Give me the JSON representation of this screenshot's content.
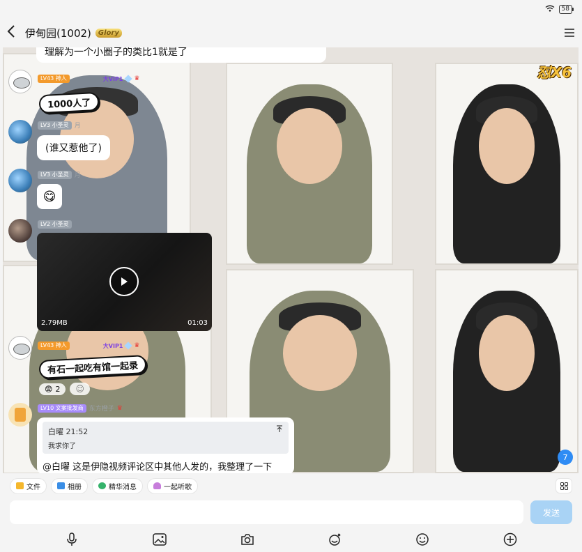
{
  "status": {
    "battery": "58"
  },
  "header": {
    "title": "伊甸园(1002)",
    "badge": "Glory"
  },
  "chat": {
    "combo": "怼X6",
    "top_message": "理解为一个小圈子的类比1就是了",
    "messages": [
      {
        "level": "LV43 神人",
        "vip": "大VIP1",
        "sticker": "1000人了"
      },
      {
        "level": "LV3 小圣灵",
        "nick": "月",
        "text": "(谁又惹他了)"
      },
      {
        "level": "LV3 小圣灵",
        "nick": "月",
        "emoji": "😋"
      },
      {
        "level": "LV2 小圣灵",
        "video": {
          "size": "2.79MB",
          "duration": "01:03"
        }
      },
      {
        "level": "LV43 神人",
        "vip": "大VIP1",
        "sticker": "有石一起吃有馆一起录"
      },
      {
        "level": "LV10 文案批发商",
        "nick": "东方橙子",
        "reply": {
          "quote_head": "白曜 21:52",
          "quote_text": "我求你了",
          "text": "@白曜 这是伊隐视频评论区中其他人发的，我整理了一下"
        }
      }
    ],
    "reaction": {
      "emoji": "😨",
      "count": "2"
    },
    "unread_count": "7"
  },
  "quickbar": [
    {
      "label": "文件",
      "icon": "folder-icon"
    },
    {
      "label": "相册",
      "icon": "photo-icon"
    },
    {
      "label": "精华消息",
      "icon": "star-icon"
    },
    {
      "label": "一起听歌",
      "icon": "music-icon"
    }
  ],
  "input": {
    "send_label": "发送",
    "placeholder": ""
  },
  "toolbar": [
    "mic-icon",
    "image-icon",
    "camera-icon",
    "sticker-icon",
    "emoji-icon",
    "plus-icon"
  ]
}
